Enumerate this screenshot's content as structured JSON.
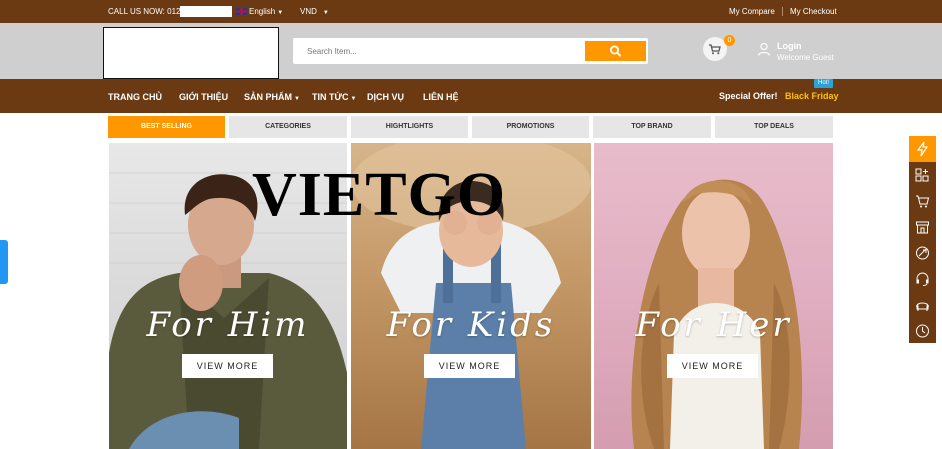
{
  "topbar": {
    "call_label": "CALL US NOW: 0123",
    "language": "English",
    "currency": "VND",
    "my_compare": "My Compare",
    "my_checkout": "My Checkout"
  },
  "header": {
    "search_placeholder": "Search Item...",
    "cart_count": "0",
    "login": "Login",
    "welcome": "Welcome Guest"
  },
  "nav": {
    "items": [
      "TRANG CHỦ",
      "GIỚI THIỆU",
      "SẢN PHẨM",
      "TIN TỨC",
      "DỊCH VỤ",
      "LIÊN HỆ"
    ],
    "special_offer": "Special Offer!",
    "black_friday": "Black Friday",
    "hot": "Hot!"
  },
  "tabs": [
    "BEST SELLING",
    "CATEGORIES",
    "HIGHTLIGHTS",
    "PROMOTIONS",
    "TOP BRAND",
    "TOP DEALS"
  ],
  "banners": [
    {
      "title": "For Him",
      "button": "VIEW MORE"
    },
    {
      "title": "For Kids",
      "button": "VIEW MORE"
    },
    {
      "title": "For Her",
      "button": "VIEW MORE"
    }
  ],
  "watermark": "VIETGO",
  "colors": {
    "brown": "#6b3a12",
    "orange": "#ff9800",
    "header_gray": "#cfcfcf"
  },
  "rail_icons": [
    "flash-icon",
    "grid-add-icon",
    "cart-icon",
    "store-icon",
    "tag-icon",
    "headset-icon",
    "sofa-icon",
    "clock-icon"
  ]
}
